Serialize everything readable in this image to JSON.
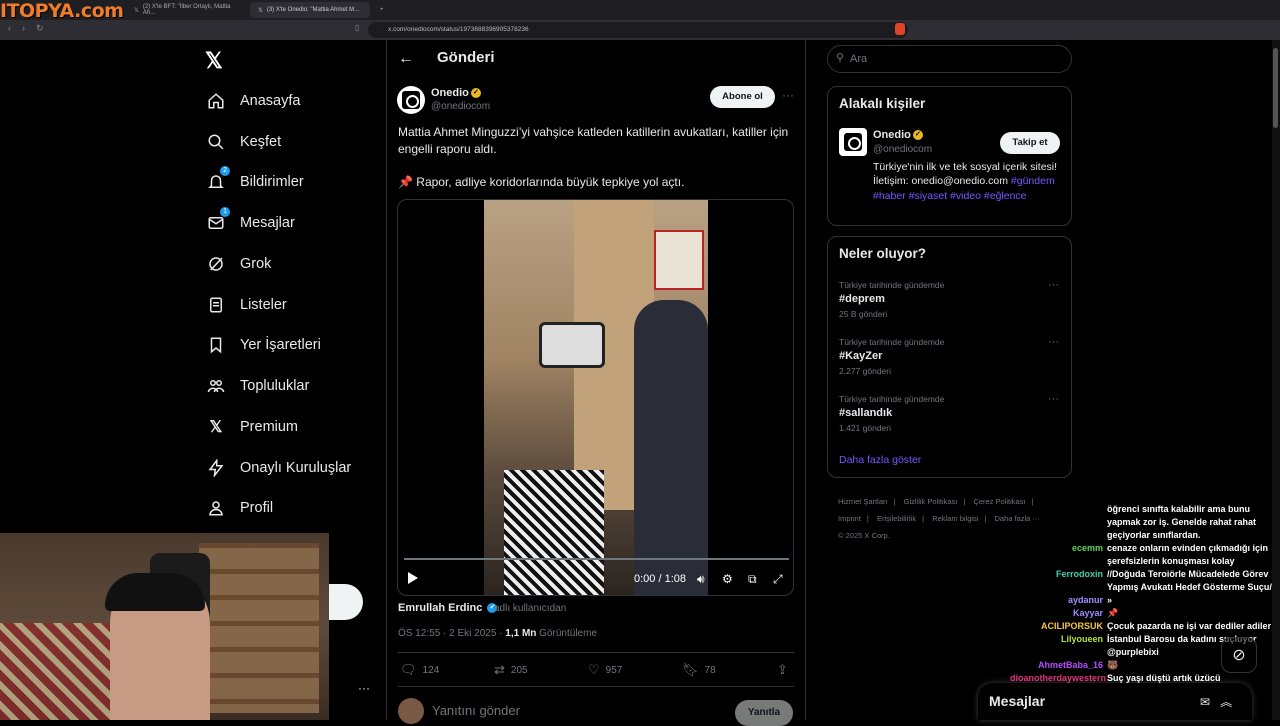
{
  "browser": {
    "logo_overlay": "ITOPYA.com",
    "tabs": [
      {
        "label": "(2) X'te BFT: \"İlber Ortaylı, Mattia Ah...",
        "active": false
      },
      {
        "label": "(3) X'te Onedio: \"Mattia Ahmet M...",
        "active": true
      }
    ],
    "new_tab": "+",
    "url": "x.com/onediocom/status/1973688396905378236"
  },
  "nav": {
    "items": [
      {
        "label": "Anasayfa",
        "icon": "home-icon"
      },
      {
        "label": "Keşfet",
        "icon": "search-icon"
      },
      {
        "label": "Bildirimler",
        "icon": "bell-icon",
        "badge": "2"
      },
      {
        "label": "Mesajlar",
        "icon": "mail-icon",
        "badge": "1"
      },
      {
        "label": "Grok",
        "icon": "grok-icon"
      },
      {
        "label": "Listeler",
        "icon": "list-icon"
      },
      {
        "label": "Yer İşaretleri",
        "icon": "bookmark-icon"
      },
      {
        "label": "Topluluklar",
        "icon": "communities-icon"
      },
      {
        "label": "Premium",
        "icon": "x-premium-icon"
      },
      {
        "label": "Onaylı Kuruluşlar",
        "icon": "lightning-icon"
      },
      {
        "label": "Profil",
        "icon": "person-icon"
      }
    ],
    "more": "···"
  },
  "header": {
    "title": "Gönderi"
  },
  "post": {
    "author_name": "Onedio",
    "author_handle": "@onediocom",
    "subscribe_label": "Abone ol",
    "more": "···",
    "text_line1": "Mattia Ahmet Minguzzi’yi vahşice katleden katillerin avukatları, katiller için engelli raporu aldı.",
    "text_line2": "📌 Rapor, adliye koridorlarında büyük tepkiye yol açtı.",
    "video_time": "0:00 / 1:08",
    "attribution_name": "Emrullah Erdinc",
    "attribution_suffix": "adlı kullanıcıdan",
    "timestamp": "ÖS 12:55 · 2 Eki 2025 · ",
    "views_count": "1,1 Mn",
    "views_label": " Görüntüleme",
    "stats": {
      "replies": "124",
      "reposts": "205",
      "likes": "957",
      "bookmarks": "78"
    },
    "reply_placeholder": "Yanıtını gönder",
    "reply_button": "Yanıtla"
  },
  "right": {
    "search_placeholder": "Ara",
    "related_title": "Alakalı kişiler",
    "related": {
      "name": "Onedio",
      "handle": "@onediocom",
      "follow_label": "Takip et",
      "bio": "Türkiye'nin ilk ve tek sosyal içerik sitesi! İletişim: onedio@onedio.com",
      "tags": "#gündem #haber #siyaset #video #eğlence"
    },
    "trends_title": "Neler oluyor?",
    "trends": [
      {
        "context": "Türkiye tarihinde gündemde",
        "name": "#deprem",
        "count": "25 B gönderi"
      },
      {
        "context": "Türkiye tarihinde gündemde",
        "name": "#KayZer",
        "count": "2.277 gönderi"
      },
      {
        "context": "Türkiye tarihinde gündemde",
        "name": "#sallandık",
        "count": "1.421 gönderi"
      }
    ],
    "show_more": "Daha fazla göster",
    "footer": [
      "Hizmet Şartları",
      "|",
      "Gizlilik Politikası",
      "|",
      "Çerez Politikası",
      "|",
      "Imprint",
      "|",
      "Erişilebilirlik",
      "|",
      "Reklam bilgisi",
      "|",
      "Daha fazla ···",
      "© 2025 X Corp."
    ]
  },
  "chat": [
    {
      "user": "",
      "msg": "öğrenci sınıfta kalabilir ama bunu yapmak zor iş. Genelde rahat rahat geçiyorlar sınıflardan.",
      "color": "#ffffff"
    },
    {
      "user": "ecemm",
      "msg": "cenaze onların evinden çıkmadığı için şerefsizlerin konuşması kolay",
      "color": "#5fd35f"
    },
    {
      "user": "Ferrodoxin",
      "msg": "//Doğuda Teroiörle Mücadelede Görev Yapmış Avukatı Hedef Gösterme Suçu//",
      "color": "#3fd3b0"
    },
    {
      "user": "aydanur",
      "msg": "»",
      "color": "#a98bff"
    },
    {
      "user": "Kayyar",
      "msg": "📌",
      "color": "#9a8cff"
    },
    {
      "user": "ACILIPORSUK",
      "msg": "Çocuk pazarda ne işi var dediler adiler",
      "color": "#f5c542"
    },
    {
      "user": "Lilyoueen",
      "msg": "İstanbul Barosu da kadını suçluyor @purplebixi",
      "color": "#b6e03b"
    },
    {
      "user": "AhmetBaba_16",
      "msg": "🐻",
      "color": "#b44bff"
    },
    {
      "user": "dioanotherdaywestern",
      "msg": "Suç yaşı düştü artık üzücü",
      "color": "#e0307a"
    }
  ],
  "messages_drawer": {
    "title": "Mesajlar"
  }
}
